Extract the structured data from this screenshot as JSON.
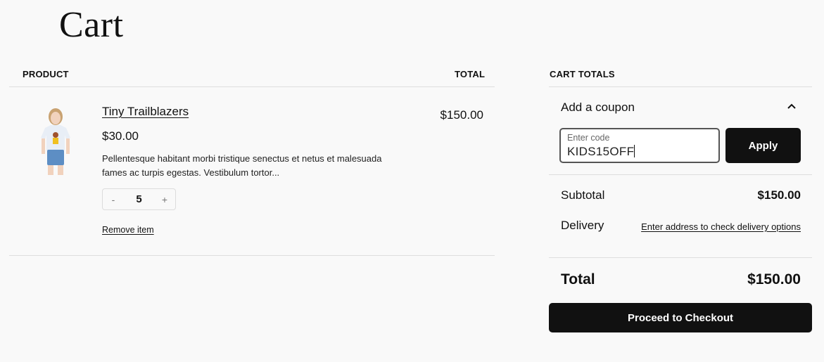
{
  "page": {
    "title": "Cart"
  },
  "table": {
    "headers": {
      "product": "PRODUCT",
      "total": "TOTAL"
    },
    "items": [
      {
        "name": "Tiny Trailblazers",
        "price": "$30.00",
        "description": "Pellentesque habitant morbi tristique senectus et netus et malesuada fames ac turpis egestas. Vestibulum tortor...",
        "quantity": "5",
        "decrement_label": "-",
        "increment_label": "+",
        "remove_label": "Remove item",
        "line_total": "$150.00",
        "image_alt": "Girl wearing white t-shirt with cartoon print and denim shorts"
      }
    ]
  },
  "cart_totals": {
    "heading": "CART TOTALS",
    "coupon": {
      "label": "Add a coupon",
      "placeholder": "Enter code",
      "value": "KIDS15OFF",
      "apply_label": "Apply",
      "expanded": true
    },
    "subtotal_label": "Subtotal",
    "subtotal_value": "$150.00",
    "delivery_label": "Delivery",
    "delivery_link": "Enter address to check delivery options",
    "total_label": "Total",
    "total_value": "$150.00",
    "checkout_label": "Proceed to Checkout"
  }
}
